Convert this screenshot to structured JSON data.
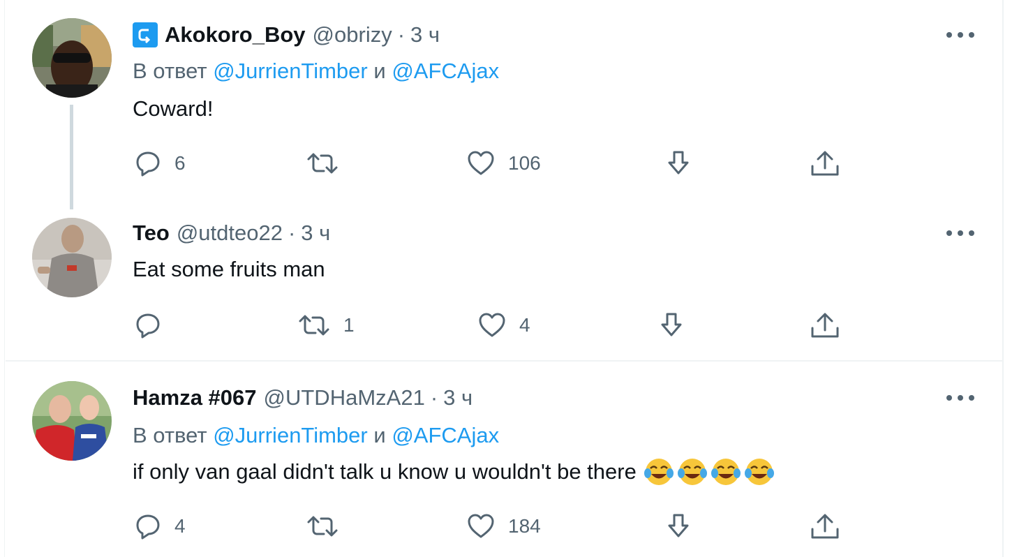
{
  "tweets": [
    {
      "display_name": "Akokoro_Boy",
      "handle": "@obrizy",
      "separator": "·",
      "time": "3 ч",
      "reply_prefix": "В ответ",
      "reply_mention_1": "@JurrienTimber",
      "reply_and": "и",
      "reply_mention_2": "@AFCAjax",
      "text": "Coward!",
      "reply_count": "6",
      "retweet_count": "",
      "like_count": "106",
      "has_badge": true,
      "badge_icon": "retweet-badge-icon"
    },
    {
      "display_name": "Teo",
      "handle": "@utdteo22",
      "separator": "·",
      "time": "3 ч",
      "text": "Eat some fruits man",
      "reply_count": "",
      "retweet_count": "1",
      "like_count": "4"
    },
    {
      "display_name": "Hamza #067",
      "handle": "@UTDHaMzA21",
      "separator": "·",
      "time": "3 ч",
      "reply_prefix": "В ответ",
      "reply_mention_1": "@JurrienTimber",
      "reply_and": "и",
      "reply_mention_2": "@AFCAjax",
      "text": "if only van gaal didn't talk u know u wouldn't be there",
      "emoji_icon": "face-with-tears-of-joy-emoji",
      "emoji_count": 4,
      "reply_count": "4",
      "retweet_count": "",
      "like_count": "184"
    }
  ],
  "icons": {
    "reply": "reply-icon",
    "retweet": "retweet-icon",
    "like": "heart-icon",
    "download": "download-icon",
    "share": "share-icon",
    "more": "more-options-icon"
  },
  "colors": {
    "accent": "#1d9bf0",
    "secondary_text": "#536471",
    "primary_text": "#0f1419",
    "thread_line": "#cfd9de",
    "divider": "#eff3f4"
  }
}
